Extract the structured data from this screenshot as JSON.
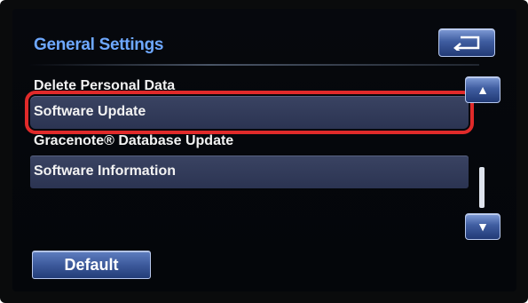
{
  "header": {
    "title": "General Settings"
  },
  "menu": {
    "items": [
      {
        "label": "Delete Personal Data"
      },
      {
        "label": "Software Update"
      },
      {
        "label": "Gracenote® Database Update"
      },
      {
        "label": "Software Information"
      }
    ]
  },
  "scroll": {
    "up_glyph": "▲",
    "down_glyph": "▼"
  },
  "footer": {
    "default_label": "Default"
  },
  "icons": {
    "back": "back-arrow-icon"
  },
  "colors": {
    "title": "#6ea8ff",
    "highlight": "#e02a2a",
    "button": "#3d5a9c"
  }
}
